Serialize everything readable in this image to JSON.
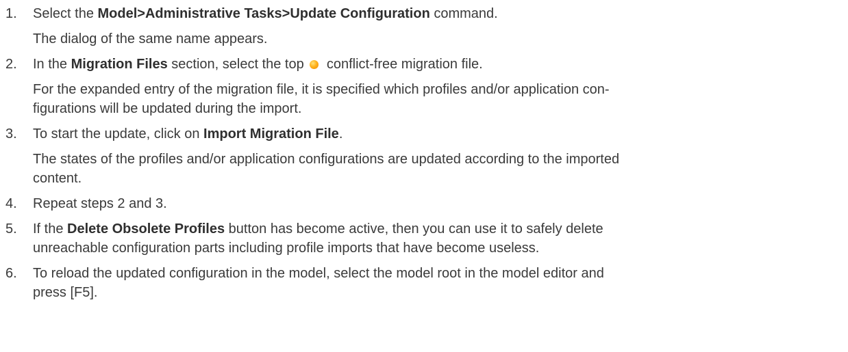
{
  "steps": [
    {
      "num": "1.",
      "pre": "Select the ",
      "bold": "Model>Administrative Tasks>Update Configuration",
      "post": " command.",
      "result": "The dialog of the same name appears."
    },
    {
      "num": "2.",
      "pre": "In the ",
      "bold": "Migration Files",
      "mid": " section, select the top ",
      "icon": "orange-status-dot-icon",
      "post": " conflict-free migration file.",
      "result_line1": "For the expanded entry of the migration file, it is specified which profiles and/or application con-",
      "result_line2": "figurations will be updated during the import."
    },
    {
      "num": "3.",
      "pre": "To start the update, click on ",
      "bold": "Import Migration File",
      "post": ".",
      "result_line1": "The states of the profiles and/or application configurations are updated according to the imported",
      "result_line2": "content."
    },
    {
      "num": "4.",
      "text": "Repeat steps 2 and 3."
    },
    {
      "num": "5.",
      "pre": "If the ",
      "bold": "Delete Obsolete Profiles",
      "post": " button has become active, then you can use it to safely delete",
      "line2": "unreachable configuration parts including profile imports that have become useless."
    },
    {
      "num": "6.",
      "line1": "To reload the updated configuration in the model, select the model root in the model editor and",
      "line2": "press [F5]."
    }
  ],
  "colors": {
    "text": "#3a3a3a",
    "icon_orange": "#f59a00"
  }
}
